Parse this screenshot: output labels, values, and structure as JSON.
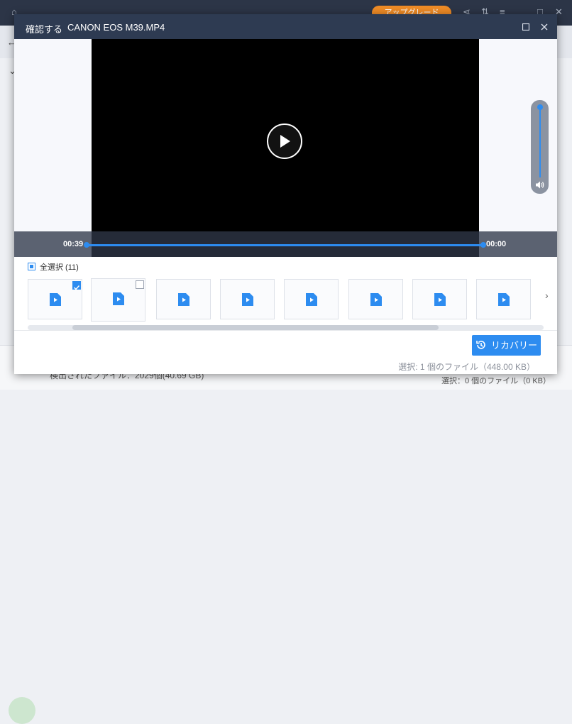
{
  "background": {
    "upgrade_label": "アップグレード",
    "footer_left": "検出されたファイル：2029個(40.69 GB)",
    "footer_right": "選択：0 個のファイル（0 KB）"
  },
  "dialog": {
    "title_prefix": "確認する",
    "file_name": "CANON EOS M39.MP4",
    "maximize_icon": "square-icon",
    "close_icon": "close-icon"
  },
  "player": {
    "current_time": "00:39",
    "remaining_time": "00:00",
    "progress": 1.0,
    "volume_level": 1.0
  },
  "selection": {
    "select_all_label": "全選択 (11)",
    "thumbnails": [
      {
        "checked": true
      },
      {
        "checked": false
      },
      {},
      {},
      {},
      {},
      {},
      {}
    ]
  },
  "footer": {
    "recover_label": "リカバリー",
    "selected_info": "選択: 1 個のファイル（448.00 KB）"
  },
  "colors": {
    "accent": "#2d8cf0",
    "title_bar": "#2e3b52",
    "upgrade": "#f08c26"
  }
}
